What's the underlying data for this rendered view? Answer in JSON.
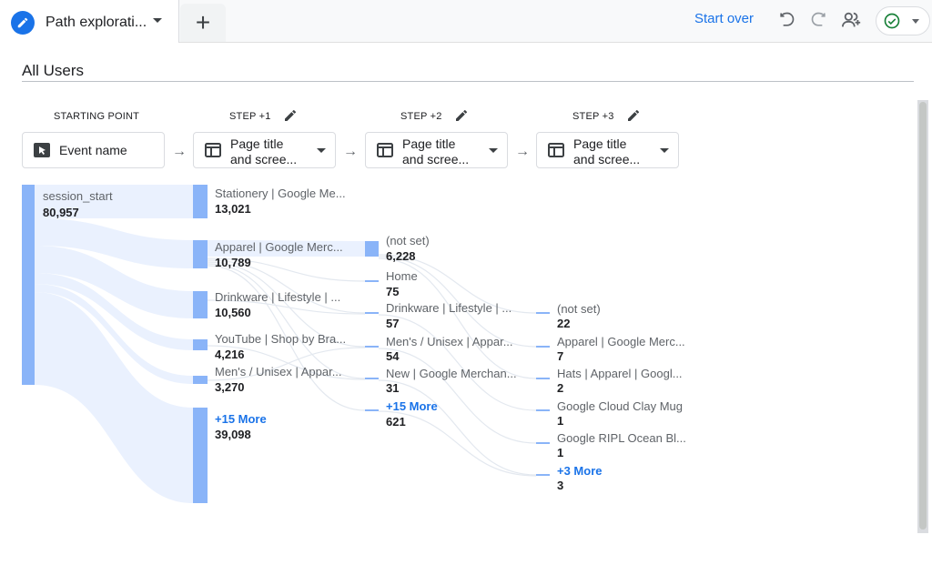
{
  "tab": {
    "title": "Path explorati...",
    "add_label": "+"
  },
  "header": {
    "start_over": "Start over"
  },
  "segment": {
    "title": "All Users"
  },
  "steps": [
    {
      "label": "STARTING POINT",
      "dimension_line1": "Event name",
      "dimension_line2": ""
    },
    {
      "label": "STEP +1",
      "dimension_line1": "Page title",
      "dimension_line2": "and scree..."
    },
    {
      "label": "STEP +2",
      "dimension_line1": "Page title",
      "dimension_line2": "and scree..."
    },
    {
      "label": "STEP +3",
      "dimension_line1": "Page title",
      "dimension_line2": "and scree..."
    }
  ],
  "columns": {
    "start": [
      {
        "label": "session_start",
        "value": "80,957"
      }
    ],
    "step1": [
      {
        "label": "Stationery | Google Me...",
        "value": "13,021"
      },
      {
        "label": "Apparel | Google Merc...",
        "value": "10,789"
      },
      {
        "label": "Drinkware | Lifestyle | ...",
        "value": "10,560"
      },
      {
        "label": "YouTube | Shop by Bra...",
        "value": "4,216"
      },
      {
        "label": "Men's / Unisex | Appar...",
        "value": "3,270"
      },
      {
        "label": "+15 More",
        "value": "39,098"
      }
    ],
    "step2": [
      {
        "label": "(not set)",
        "value": "6,228"
      },
      {
        "label": "Home",
        "value": "75"
      },
      {
        "label": "Drinkware | Lifestyle | ...",
        "value": "57"
      },
      {
        "label": "Men's / Unisex | Appar...",
        "value": "54"
      },
      {
        "label": "New | Google Merchan...",
        "value": "31"
      },
      {
        "label": "+15 More",
        "value": "621"
      }
    ],
    "step3": [
      {
        "label": "(not set)",
        "value": "22"
      },
      {
        "label": "Apparel | Google Merc...",
        "value": "7"
      },
      {
        "label": "Hats | Apparel | Googl...",
        "value": "2"
      },
      {
        "label": "Google Cloud Clay Mug",
        "value": "1"
      },
      {
        "label": "Google RIPL Ocean Bl...",
        "value": "1"
      },
      {
        "label": "+3 More",
        "value": "3"
      }
    ]
  },
  "colors": {
    "accent": "#1a73e8",
    "node": "#8ab4f8",
    "flow": "#e8f0fe",
    "success": "#188038"
  },
  "icons": [
    "pencil-icon",
    "undo-icon",
    "redo-icon",
    "share-users-icon",
    "check-circle-icon",
    "cursor-icon",
    "table-icon"
  ]
}
